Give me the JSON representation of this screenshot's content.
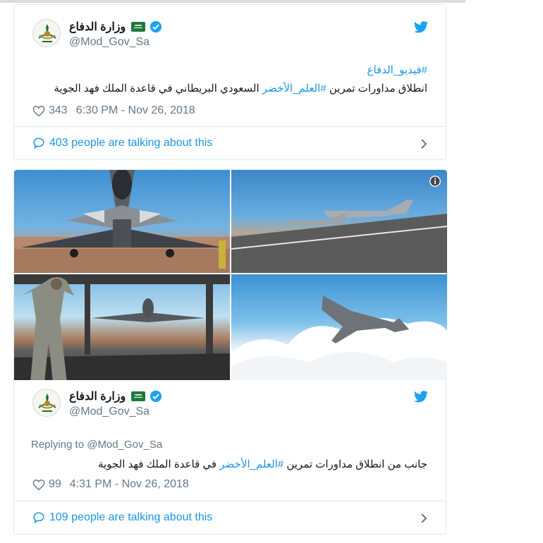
{
  "account": {
    "display_name": "وزارة الدفاع",
    "handle": "@Mod_Gov_Sa"
  },
  "tweet1": {
    "hashtag_line": "#فيديو_الدفاع",
    "text_before": "انطلاق مداورات تمرين ",
    "hashtag": "#العلم_الأخضر",
    "text_after": " السعودي البريطاني في قاعدة الملك فهد الجوية",
    "likes": "343",
    "timestamp": "6:30 PM - Nov 26, 2018",
    "talking": "403 people are talking about this"
  },
  "tweet2": {
    "replying_to": "Replying to @Mod_Gov_Sa",
    "text_before": "جانب من انطلاق مداورات تمرين ",
    "hashtag": "#العلم_الأخضر",
    "text_after": " في قاعدة الملك فهد الجوية",
    "likes": "99",
    "timestamp": "4:31 PM - Nov 26, 2018",
    "talking": "109 people are talking about this"
  },
  "colors": {
    "link_blue": "#1b95e0",
    "meta_gray": "#657786",
    "border": "#e1e8ed"
  },
  "icons": [
    "verified-icon",
    "saudi-flag-icon",
    "twitter-bird-icon",
    "heart-icon",
    "comment-bubble-icon",
    "chevron-right-icon",
    "info-icon"
  ]
}
